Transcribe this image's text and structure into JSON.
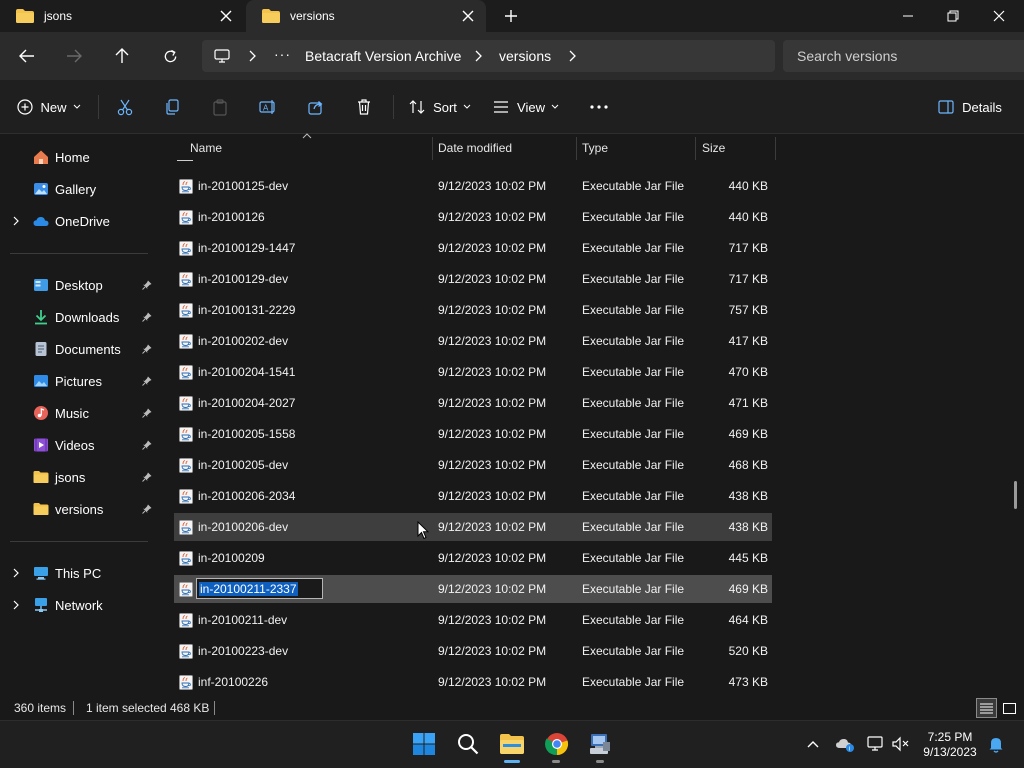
{
  "tabs": [
    {
      "label": "jsons",
      "active": false
    },
    {
      "label": "versions",
      "active": true
    }
  ],
  "breadcrumb": [
    "Betacraft Version Archive",
    "versions"
  ],
  "search": {
    "placeholder": "Search versions"
  },
  "toolbar": {
    "new_label": "New",
    "sort_label": "Sort",
    "view_label": "View",
    "details_label": "Details"
  },
  "sidebar": {
    "top": [
      {
        "label": "Home",
        "icon": "home-icon"
      },
      {
        "label": "Gallery",
        "icon": "gallery-icon"
      },
      {
        "label": "OneDrive",
        "icon": "cloud-icon"
      }
    ],
    "pinned": [
      {
        "label": "Desktop",
        "icon": "desktop-icon"
      },
      {
        "label": "Downloads",
        "icon": "download-icon"
      },
      {
        "label": "Documents",
        "icon": "documents-icon"
      },
      {
        "label": "Pictures",
        "icon": "pictures-icon"
      },
      {
        "label": "Music",
        "icon": "music-icon"
      },
      {
        "label": "Videos",
        "icon": "videos-icon"
      },
      {
        "label": "jsons",
        "icon": "folder-icon"
      },
      {
        "label": "versions",
        "icon": "folder-icon"
      }
    ],
    "bottom": [
      {
        "label": "This PC",
        "icon": "pc-icon"
      },
      {
        "label": "Network",
        "icon": "network-icon"
      }
    ]
  },
  "columns": {
    "name": "Name",
    "date": "Date modified",
    "type": "Type",
    "size": "Size"
  },
  "files": [
    {
      "name": "in-20100125-dev",
      "date": "9/12/2023 10:02 PM",
      "type": "Executable Jar File",
      "size": "440 KB"
    },
    {
      "name": "in-20100126",
      "date": "9/12/2023 10:02 PM",
      "type": "Executable Jar File",
      "size": "440 KB"
    },
    {
      "name": "in-20100129-1447",
      "date": "9/12/2023 10:02 PM",
      "type": "Executable Jar File",
      "size": "717 KB"
    },
    {
      "name": "in-20100129-dev",
      "date": "9/12/2023 10:02 PM",
      "type": "Executable Jar File",
      "size": "717 KB"
    },
    {
      "name": "in-20100131-2229",
      "date": "9/12/2023 10:02 PM",
      "type": "Executable Jar File",
      "size": "757 KB"
    },
    {
      "name": "in-20100202-dev",
      "date": "9/12/2023 10:02 PM",
      "type": "Executable Jar File",
      "size": "417 KB"
    },
    {
      "name": "in-20100204-1541",
      "date": "9/12/2023 10:02 PM",
      "type": "Executable Jar File",
      "size": "470 KB"
    },
    {
      "name": "in-20100204-2027",
      "date": "9/12/2023 10:02 PM",
      "type": "Executable Jar File",
      "size": "471 KB"
    },
    {
      "name": "in-20100205-1558",
      "date": "9/12/2023 10:02 PM",
      "type": "Executable Jar File",
      "size": "469 KB"
    },
    {
      "name": "in-20100205-dev",
      "date": "9/12/2023 10:02 PM",
      "type": "Executable Jar File",
      "size": "468 KB"
    },
    {
      "name": "in-20100206-2034",
      "date": "9/12/2023 10:02 PM",
      "type": "Executable Jar File",
      "size": "438 KB"
    },
    {
      "name": "in-20100206-dev",
      "date": "9/12/2023 10:02 PM",
      "type": "Executable Jar File",
      "size": "438 KB",
      "state": "hover"
    },
    {
      "name": "in-20100209",
      "date": "9/12/2023 10:02 PM",
      "type": "Executable Jar File",
      "size": "445 KB"
    },
    {
      "name": "in-20100211-2337",
      "date": "9/12/2023 10:02 PM",
      "type": "Executable Jar File",
      "size": "469 KB",
      "state": "renaming"
    },
    {
      "name": "in-20100211-dev",
      "date": "9/12/2023 10:02 PM",
      "type": "Executable Jar File",
      "size": "464 KB"
    },
    {
      "name": "in-20100223-dev",
      "date": "9/12/2023 10:02 PM",
      "type": "Executable Jar File",
      "size": "520 KB"
    },
    {
      "name": "inf-20100226",
      "date": "9/12/2023 10:02 PM",
      "type": "Executable Jar File",
      "size": "473 KB"
    }
  ],
  "status": {
    "item_count": "360 items",
    "selection": "1 item selected",
    "selection_size": "468 KB"
  },
  "clock": {
    "time": "7:25 PM",
    "date": "9/13/2023"
  },
  "colors": {
    "accent": "#0f5fbf",
    "folder": "#f3c24b",
    "selected_row": "#4d4d4d"
  }
}
